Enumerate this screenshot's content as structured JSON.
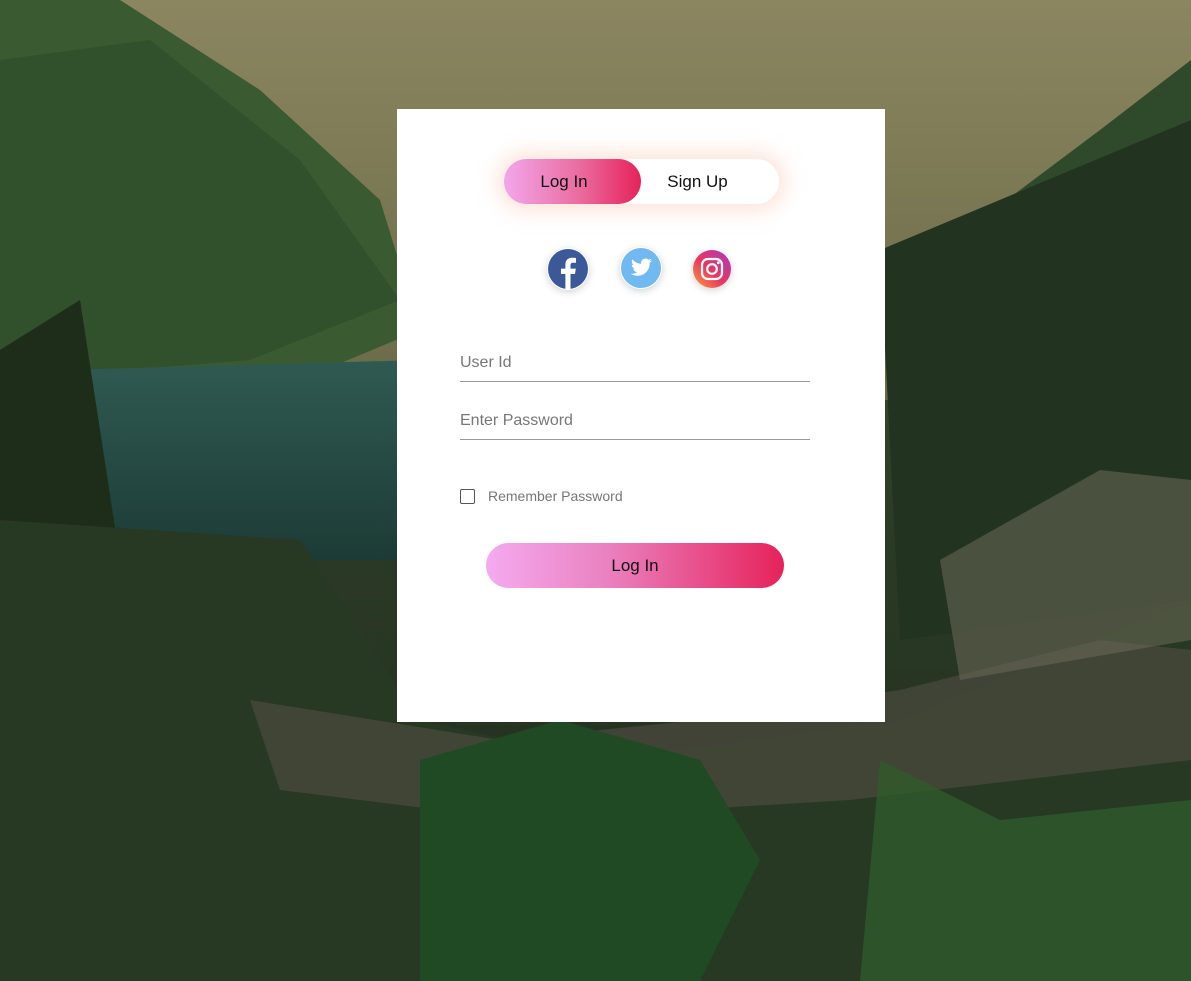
{
  "toggle": {
    "login_label": "Log In",
    "signup_label": "Sign Up",
    "active": "login"
  },
  "social": {
    "icons": [
      "facebook-icon",
      "twitter-icon",
      "instagram-icon"
    ]
  },
  "form": {
    "user_placeholder": "User Id",
    "user_value": "",
    "password_placeholder": "Enter Password",
    "password_value": "",
    "remember_label": "Remember Password",
    "remember_checked": false,
    "submit_label": "Log In"
  },
  "colors": {
    "accent_start": "#f5aaf0",
    "accent_end": "#e6225b",
    "facebook": "#3b5998",
    "twitter": "#6fb8f0",
    "card": "#ffffff"
  }
}
